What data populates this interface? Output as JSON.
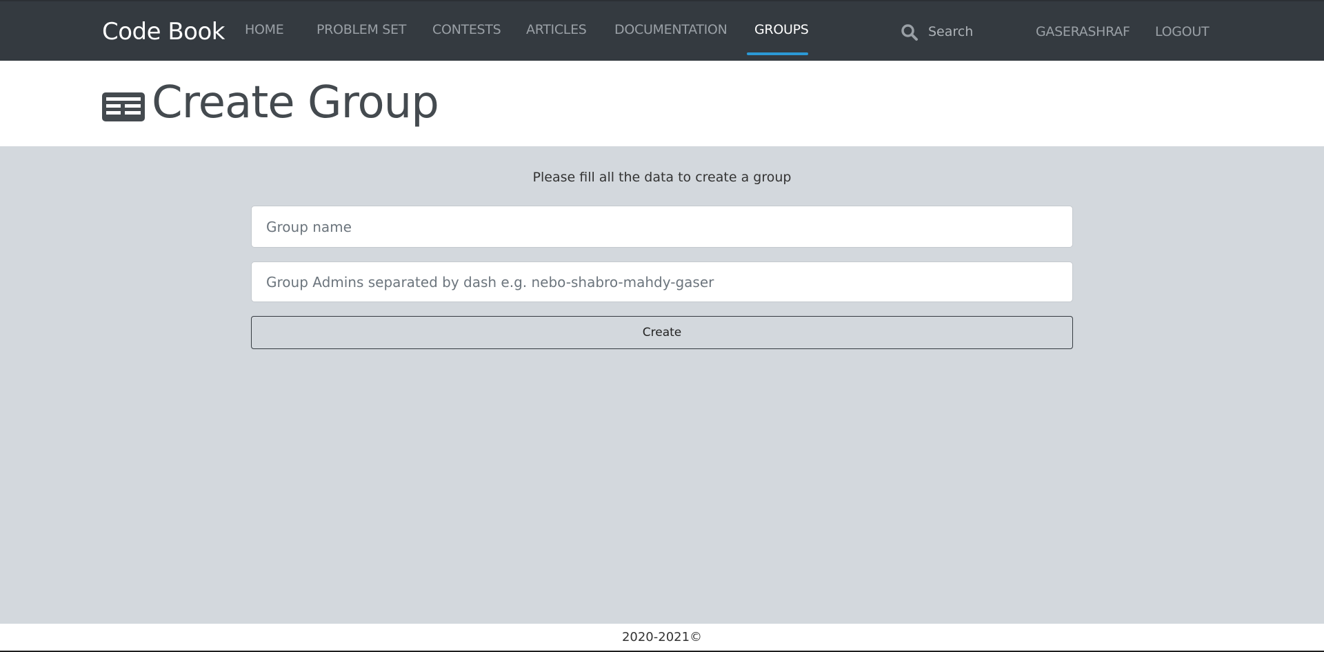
{
  "nav": {
    "brand": "Code Book",
    "items": [
      {
        "label": "HOME"
      },
      {
        "label": "PROBLEM SET"
      },
      {
        "label": "CONTESTS"
      },
      {
        "label": "ARTICLES"
      },
      {
        "label": "DOCUMENTATION"
      },
      {
        "label": "GROUPS"
      }
    ],
    "active_item": "GROUPS",
    "search_placeholder": "Search",
    "user": "GASERASHRAF",
    "logout": "LOGOUT",
    "accent_color": "#2b99d6"
  },
  "header": {
    "title": "Create Group",
    "icon": "newspaper-icon"
  },
  "form": {
    "instructions": "Please fill all the data to create a group",
    "group_name_placeholder": "Group name",
    "group_name_value": "",
    "group_admins_placeholder": "Group Admins separated by dash e.g. nebo-shabro-mahdy-gaser",
    "group_admins_value": "",
    "create_label": "Create"
  },
  "footer": {
    "text": "2020-2021©"
  }
}
